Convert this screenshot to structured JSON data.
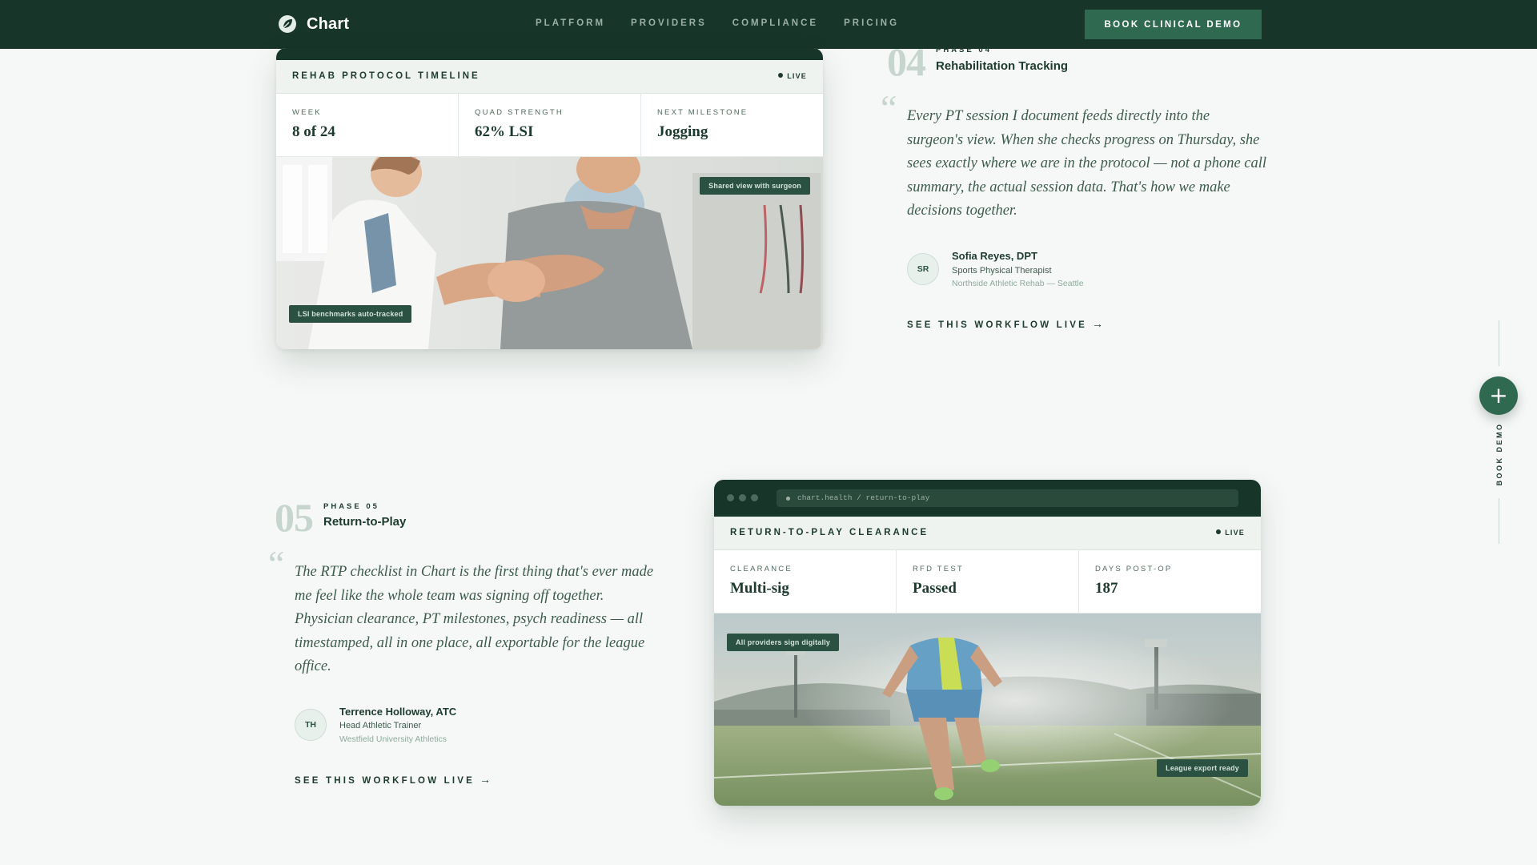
{
  "nav": {
    "brand": "Chart",
    "links": [
      "PLATFORM",
      "PROVIDERS",
      "COMPLIANCE",
      "PRICING"
    ],
    "cta": "BOOK CLINICAL DEMO"
  },
  "rehab_card": {
    "title": "REHAB PROTOCOL TIMELINE",
    "live": "LIVE",
    "stats": [
      {
        "label": "WEEK",
        "value": "8 of 24"
      },
      {
        "label": "QUAD STRENGTH",
        "value": "62% LSI"
      },
      {
        "label": "NEXT MILESTONE",
        "value": "Jogging"
      }
    ],
    "chip_top": "Shared view with surgeon",
    "chip_bottom": "LSI benchmarks auto-tracked"
  },
  "phase4": {
    "number": "04",
    "tag": "PHASE 04",
    "title": "Rehabilitation Tracking",
    "quote": "Every PT session I document feeds directly into the surgeon's view. When she checks progress on Thursday, she sees exactly where we are in the protocol — not a phone call summary, the actual session data. That's how we make decisions together.",
    "initials": "SR",
    "name": "Sofia Reyes, DPT",
    "role": "Sports Physical Therapist",
    "org": "Northside Athletic Rehab — Seattle",
    "link": "SEE THIS WORKFLOW LIVE"
  },
  "phase5": {
    "number": "05",
    "tag": "PHASE 05",
    "title": "Return-to-Play",
    "quote": "The RTP checklist in Chart is the first thing that's ever made me feel like the whole team was signing off together. Physician clearance, PT milestones, psych readiness — all timestamped, all in one place, all exportable for the league office.",
    "initials": "TH",
    "name": "Terrence Holloway, ATC",
    "role": "Head Athletic Trainer",
    "org": "Westfield University Athletics",
    "link": "SEE THIS WORKFLOW LIVE"
  },
  "rtp_card": {
    "url": "chart.health / return-to-play",
    "title": "RETURN-TO-PLAY CLEARANCE",
    "live": "LIVE",
    "stats": [
      {
        "label": "CLEARANCE",
        "value": "Multi-sig"
      },
      {
        "label": "RFD TEST",
        "value": "Passed"
      },
      {
        "label": "DAYS POST-OP",
        "value": "187"
      }
    ],
    "chip_top": "All providers sign digitally",
    "chip_bottom": "League export ready"
  },
  "rail": {
    "label": "BOOK DEMO",
    "plus": "+"
  },
  "icons": {
    "brand": "leaf-logo-icon",
    "arrow": "arrow-right-icon",
    "quote": "quote-mark-icon",
    "plus": "plus-icon"
  },
  "colors": {
    "nav_bg": "#173528",
    "accent": "#2f6a50",
    "page_bg": "#f6f8f7",
    "text": "#1d3a2e"
  }
}
